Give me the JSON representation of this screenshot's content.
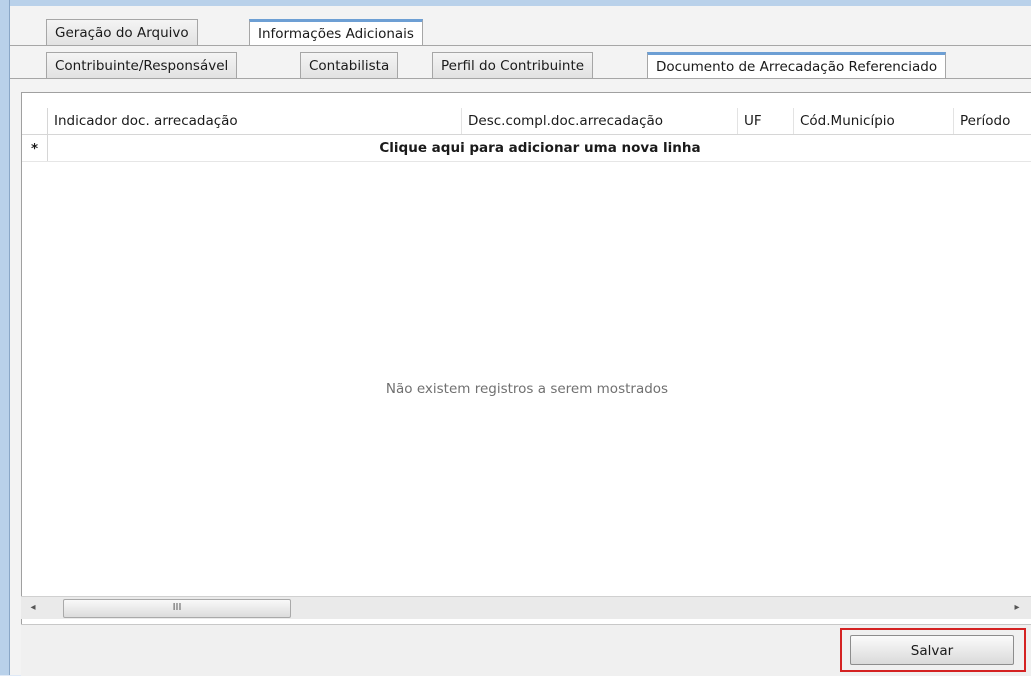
{
  "tabs_top": [
    {
      "label": "Geração do Arquivo",
      "active": false
    },
    {
      "label": "Informações Adicionais",
      "active": true
    }
  ],
  "tabs_sub": [
    {
      "label": "Contribuinte/Responsável",
      "active": false
    },
    {
      "label": "Contabilista",
      "active": false
    },
    {
      "label": "Perfil do Contribuinte",
      "active": false
    },
    {
      "label": "Documento de Arrecadação Referenciado",
      "active": true
    }
  ],
  "grid": {
    "columns": [
      "Indicador doc. arrecadação",
      "Desc.compl.doc.arrecadação",
      "UF",
      "Cód.Município",
      "Período"
    ],
    "new_row_marker": "*",
    "new_row_text": "Clique aqui para adicionar uma nova linha",
    "empty_message": "Não existem registros a serem mostrados"
  },
  "scrollbar": {
    "left_arrow": "◂",
    "right_arrow": "▸",
    "grip": "III"
  },
  "actions": {
    "save_label": "Salvar"
  },
  "colors": {
    "highlight": "#d42222",
    "active_tab_accent": "#6d9fd4"
  }
}
